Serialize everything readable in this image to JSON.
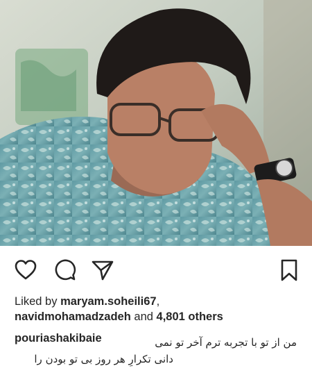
{
  "post": {
    "image": {
      "description_icon": "portrait-photo",
      "alt": ""
    },
    "actions": {
      "like_icon": "heart-icon",
      "comment_icon": "comment-icon",
      "share_icon": "send-icon",
      "save_icon": "bookmark-icon"
    },
    "likes": {
      "prefix": "Liked by",
      "user1": "maryam.soheili67",
      "separator": ",",
      "user2": "navidmohamadzadeh",
      "joiner": "and",
      "others": "4,801 others"
    },
    "caption": {
      "owner": "pouriashakibaie",
      "line1": "من از تو با تجربه ترم آخر تو نمی",
      "line2": "دانی تکرارِ هر روز بی تو بودن را"
    }
  },
  "colors": {
    "text": "#262626",
    "background": "#ffffff"
  }
}
